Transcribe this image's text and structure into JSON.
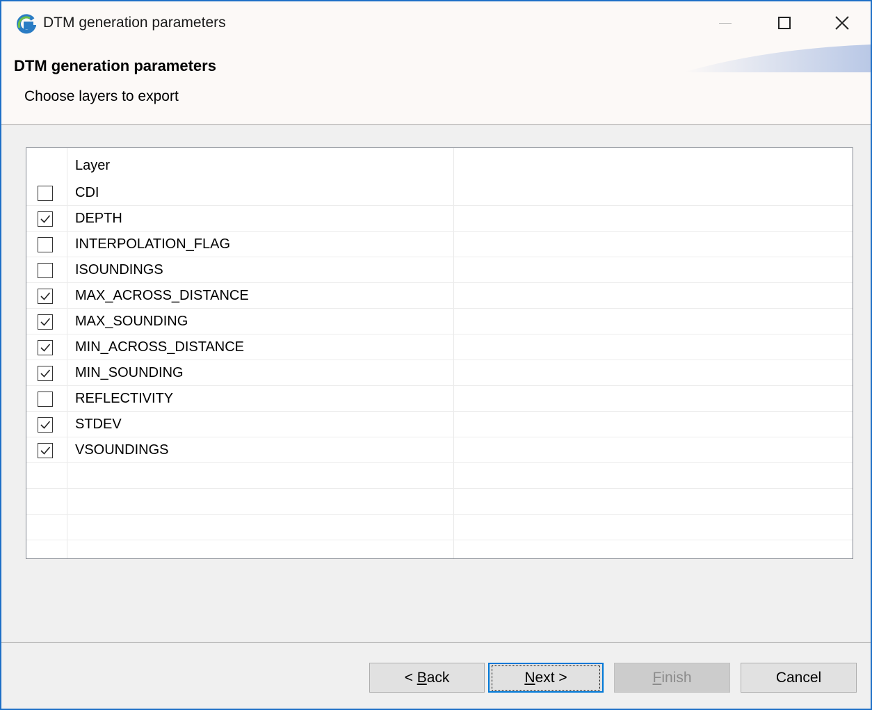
{
  "window": {
    "title": "DTM generation parameters",
    "icon": "app-g-icon",
    "accent": "#1e6fc7"
  },
  "header": {
    "title": "DTM generation parameters",
    "subtitle": "Choose layers to export"
  },
  "table": {
    "column_header": "Layer",
    "rows": [
      {
        "label": "CDI",
        "checked": false
      },
      {
        "label": "DEPTH",
        "checked": true
      },
      {
        "label": "INTERPOLATION_FLAG",
        "checked": false
      },
      {
        "label": "ISOUNDINGS",
        "checked": false
      },
      {
        "label": "MAX_ACROSS_DISTANCE",
        "checked": true
      },
      {
        "label": "MAX_SOUNDING",
        "checked": true
      },
      {
        "label": "MIN_ACROSS_DISTANCE",
        "checked": true
      },
      {
        "label": "MIN_SOUNDING",
        "checked": true
      },
      {
        "label": "REFLECTIVITY",
        "checked": false
      },
      {
        "label": "STDEV",
        "checked": true
      },
      {
        "label": "VSOUNDINGS",
        "checked": true
      }
    ]
  },
  "buttons": {
    "back": {
      "prefix": "< ",
      "mnemonic": "B",
      "rest": "ack"
    },
    "next": {
      "mnemonic": "N",
      "rest": "ext >"
    },
    "finish": {
      "mnemonic": "F",
      "rest": "inish",
      "disabled": true
    },
    "cancel": "Cancel"
  }
}
